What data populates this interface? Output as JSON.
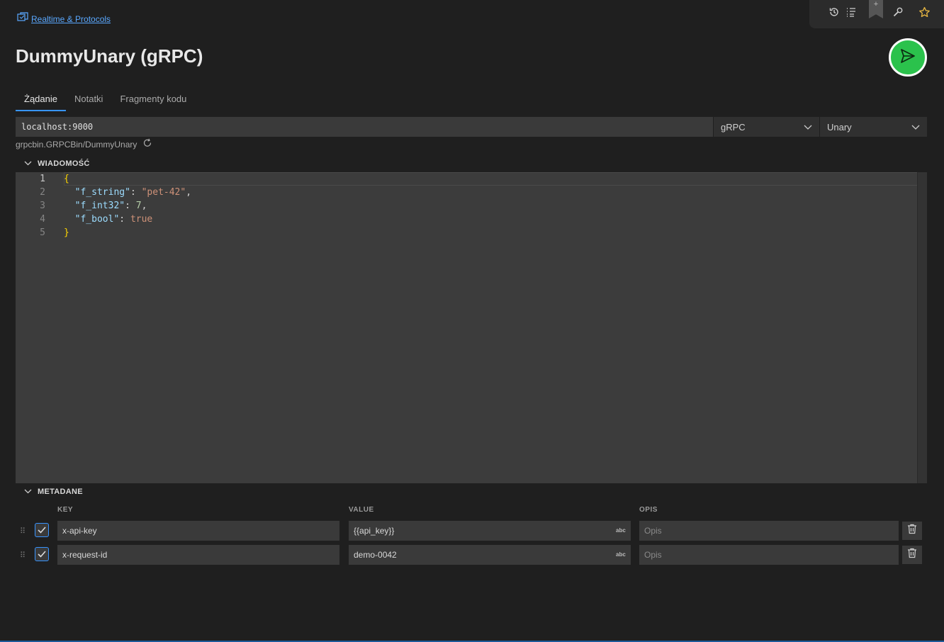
{
  "breadcrumb": {
    "label": "Realtime & Protocols"
  },
  "page_title": "DummyUnary (gRPC)",
  "tabs": [
    {
      "label": "Żądanie"
    },
    {
      "label": "Notatki"
    },
    {
      "label": "Fragmenty kodu"
    }
  ],
  "request": {
    "url": "localhost:9000",
    "protocol": "gRPC",
    "call_type": "Unary",
    "method_path": "grpcbin.GRPCBin/DummyUnary"
  },
  "message": {
    "section_label": "WIADOMOŚĆ",
    "line_numbers": [
      "1",
      "2",
      "3",
      "4",
      "5"
    ],
    "lines": [
      {
        "open": "{"
      },
      {
        "key": "\"f_string\"",
        "colon": ": ",
        "value": "\"pet-42\"",
        "comma": ","
      },
      {
        "key": "\"f_int32\"",
        "colon": ": ",
        "value": "7",
        "comma": ","
      },
      {
        "key": "\"f_bool\"",
        "colon": ": ",
        "value": "true",
        "comma": ""
      },
      {
        "close": "}"
      }
    ]
  },
  "metadata": {
    "section_label": "METADANE",
    "columns": {
      "key": "KEY",
      "value": "VALUE",
      "description": "OPIS"
    },
    "type_badge": "abc",
    "rows": [
      {
        "key": "x-api-key",
        "value": "{{api_key}}",
        "description_placeholder": "Opis"
      },
      {
        "key": "x-request-id",
        "value": "demo-0042",
        "description_placeholder": "Opis"
      }
    ]
  },
  "colors": {
    "accent": "#3794ff",
    "send_button": "#2bc24c",
    "link": "#5aa8ff",
    "background": "#1f1f1f"
  },
  "icons": {
    "toolbar": [
      "history-icon",
      "list-icon",
      "bookmark-add-icon",
      "wrench-icon",
      "star-icon"
    ],
    "send": "send-icon"
  }
}
